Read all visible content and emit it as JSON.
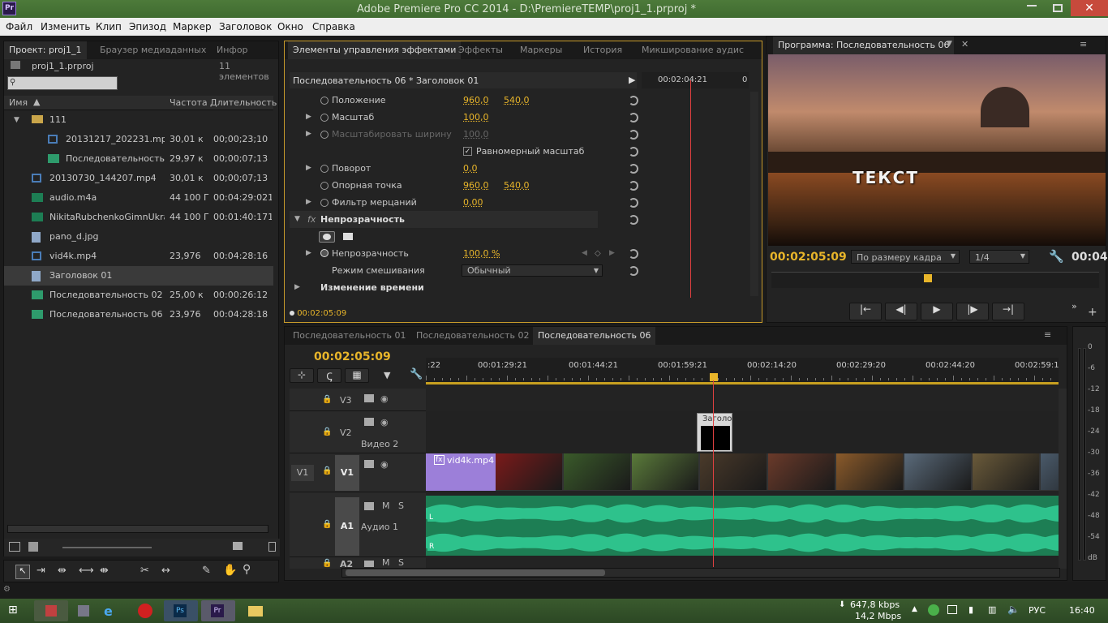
{
  "window": {
    "title": "Adobe Premiere Pro CC 2014 - D:\\PremiereTEMP\\proj1_1.prproj *",
    "app_badge": "Pr"
  },
  "menu": [
    "Файл",
    "Изменить",
    "Клип",
    "Эпизод",
    "Маркер",
    "Заголовок",
    "Окно",
    "Справка"
  ],
  "project": {
    "tabs": [
      "Проект: proj1_1",
      "Браузер медиаданных",
      "Инфор"
    ],
    "filename": "proj1_1.prproj",
    "count": "11 элементов",
    "search_placeholder": "",
    "columns": [
      "Имя",
      "Частота",
      "Длительность"
    ],
    "items": [
      {
        "name": "111",
        "rate": "",
        "duration": "",
        "type": "folder",
        "indent": 0
      },
      {
        "name": "20131217_202231.mp",
        "rate": "30,01 к",
        "duration": "00;00;23;10",
        "type": "video",
        "indent": 1
      },
      {
        "name": "Последовательность",
        "rate": "29,97 к",
        "duration": "00;00;07;13",
        "type": "sequence",
        "indent": 1
      },
      {
        "name": "20130730_144207.mp4",
        "rate": "30,01 к",
        "duration": "00;00;07;13",
        "type": "video",
        "indent": 0
      },
      {
        "name": "audio.m4a",
        "rate": "44 100 Г",
        "duration": "00:04:29:021",
        "type": "audio",
        "indent": 0
      },
      {
        "name": "NikitaRubchenkoGimnUkra",
        "rate": "44 100 Г",
        "duration": "00:01:40:171",
        "type": "audio",
        "indent": 0
      },
      {
        "name": "pano_d.jpg",
        "rate": "",
        "duration": "",
        "type": "image",
        "indent": 0
      },
      {
        "name": "vid4k.mp4",
        "rate": "23,976",
        "duration": "00:04:28:16",
        "type": "video",
        "indent": 0
      },
      {
        "name": "Заголовок 01",
        "rate": "",
        "duration": "",
        "type": "title",
        "indent": 0
      },
      {
        "name": "Последовательность 02",
        "rate": "25,00 к",
        "duration": "00:00:26:12",
        "type": "sequence",
        "indent": 0
      },
      {
        "name": "Последовательность 06",
        "rate": "23,976",
        "duration": "00:04:28:18",
        "type": "sequence",
        "indent": 0
      }
    ]
  },
  "effects": {
    "tabs": [
      "Элементы управления эффектами",
      "Эффекты",
      "Маркеры",
      "История",
      "Микширование аудис"
    ],
    "header": "Последовательность 06 * Заголовок 01",
    "ruler_time": "00:02:04:21",
    "ruler_end": "0",
    "params": [
      {
        "label": "Положение",
        "v1": "960,0",
        "v2": "540,0"
      },
      {
        "label": "Масштаб",
        "v1": "100,0",
        "v2": ""
      },
      {
        "label": "Масштабировать ширину",
        "v1": "100,0",
        "v2": ""
      },
      {
        "label": "Равномерный масштаб",
        "v1": "",
        "v2": ""
      },
      {
        "label": "Поворот",
        "v1": "0,0",
        "v2": ""
      },
      {
        "label": "Опорная точка",
        "v1": "960,0",
        "v2": "540,0"
      },
      {
        "label": "Фильтр мерцаний",
        "v1": "0,00",
        "v2": ""
      }
    ],
    "opacity_section": "Непрозрачность",
    "opacity_label": "Непрозрачность",
    "opacity_value": "100,0 %",
    "blend_label": "Режим смешивания",
    "blend_value": "Обычный",
    "time_remap": "Изменение времени",
    "timecode": "00:02:05:09",
    "fx_badge": "fx"
  },
  "program": {
    "tab": "Программа: Последовательность 06",
    "overlay_text": "ТЕКСТ",
    "timecode": "00:02:05:09",
    "fit": "По размеру кадра",
    "quality": "1/4",
    "duration": "00:04:"
  },
  "timeline": {
    "tabs": [
      "Последовательность 01",
      "Последовательность 02",
      "Последовательность 06"
    ],
    "timecode": "00:02:05:09",
    "ruler": [
      ":22",
      "00:01:29:21",
      "00:01:44:21",
      "00:01:59:21",
      "00:02:14:20",
      "00:02:29:20",
      "00:02:44:20",
      "00:02:59:1"
    ],
    "tracks": {
      "v3": "V3",
      "v2": "V2",
      "v2_name": "Видео 2",
      "v1_src": "V1",
      "v1": "V1",
      "a1": "A1",
      "a1_name": "Аудио 1",
      "a2": "A2"
    },
    "clip_name": "vid4k.mp4",
    "title_clip": "Заголо",
    "audio_l": "L",
    "audio_r": "R",
    "mute": "M",
    "solo": "S",
    "meter_ticks": [
      "0",
      "-6",
      "-12",
      "-18",
      "-24",
      "-30",
      "-36",
      "-42",
      "-48",
      "-54",
      "dB"
    ]
  },
  "taskbar": {
    "speed_down": "647,8 kbps",
    "speed_up": "14,2 Mbps",
    "lang": "РУС",
    "clock": "16:40"
  },
  "colors": {
    "accent": "#e8b52a",
    "title_green": "#4d7a3a",
    "audio_wave": "#2ec28c",
    "clip_purple": "#9c7fd9",
    "playhead": "#e04040"
  }
}
